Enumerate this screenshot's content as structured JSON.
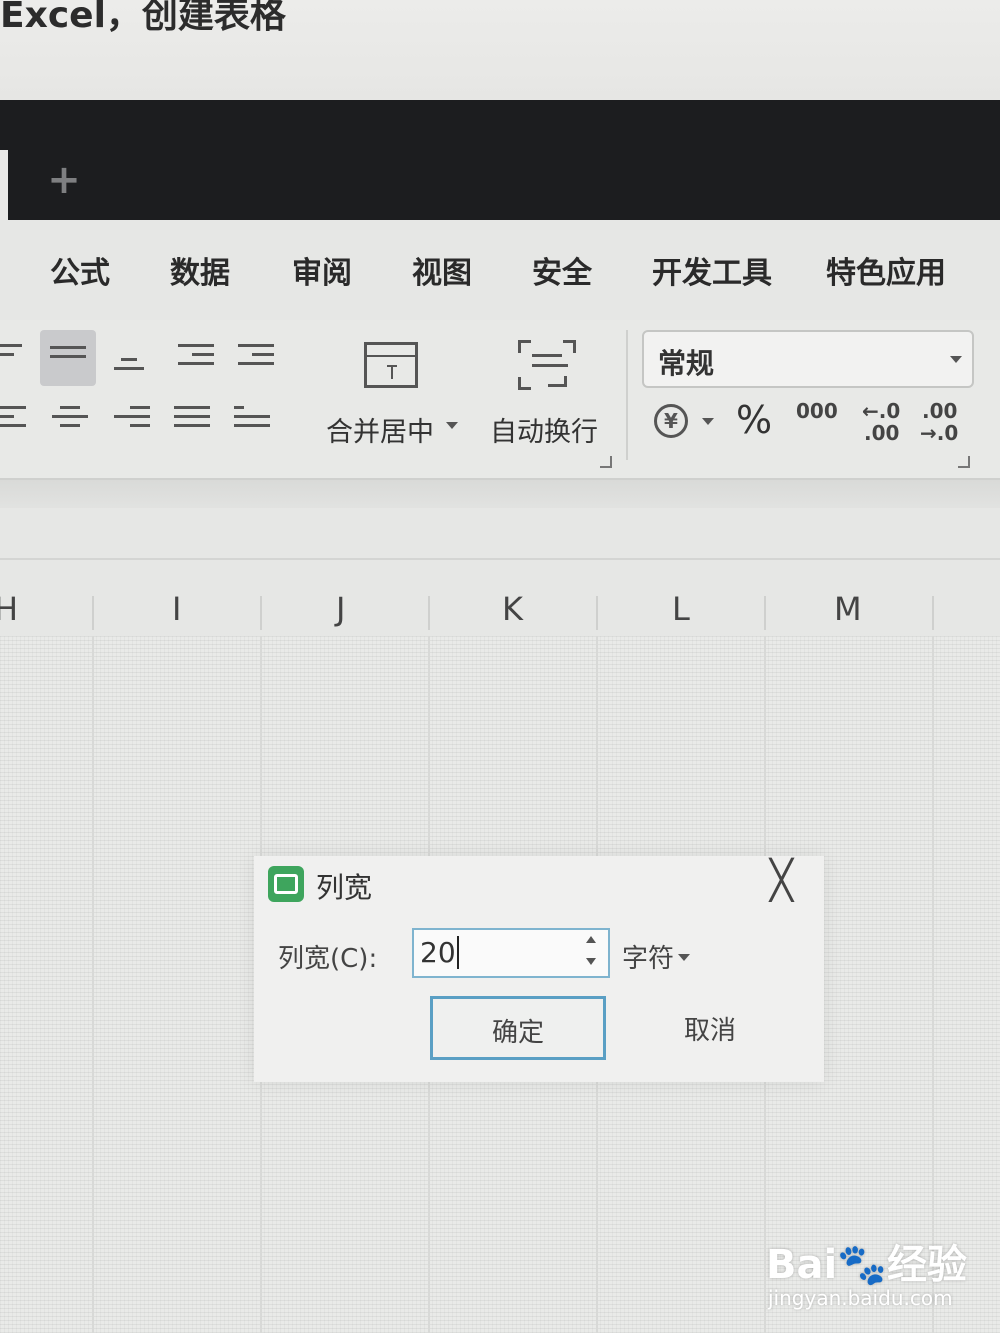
{
  "caption": {
    "text": "Excel，创建表格"
  },
  "tabbar": {
    "add_tab_glyph": "+"
  },
  "menu": {
    "items": [
      "公式",
      "数据",
      "审阅",
      "视图",
      "安全",
      "开发工具",
      "特色应用"
    ]
  },
  "ribbon": {
    "merge_center_label": "合并居中",
    "wrap_text_label": "自动换行",
    "number_format_value": "常规",
    "percent_glyph": "%",
    "thousands_glyph": "000",
    "inc_decimal_glyph_top": "←.0",
    "inc_decimal_glyph_bottom": ".00",
    "dec_decimal_glyph_top": ".00",
    "dec_decimal_glyph_bottom": "→.0"
  },
  "columns": [
    "H",
    "I",
    "J",
    "K",
    "L",
    "M"
  ],
  "dialog": {
    "title": "列宽",
    "field_label": "列宽(C):",
    "field_value": "20",
    "unit_label": "字符",
    "ok_label": "确定",
    "cancel_label": "取消",
    "close_glyph": "╳"
  },
  "watermark": {
    "main": "Bai🐾经验",
    "sub": "jingyan.baidu.com"
  }
}
